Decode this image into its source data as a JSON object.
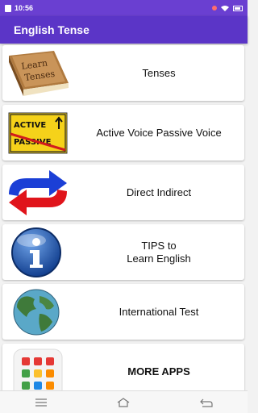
{
  "status": {
    "time": "10:56"
  },
  "app": {
    "title": "English Tense"
  },
  "items": [
    {
      "label": "Tenses",
      "icon": "book-icon",
      "thumb_text": [
        "Learn",
        "Tenses"
      ]
    },
    {
      "label": "Active Voice Passive Voice",
      "icon": "active-passive-sign-icon",
      "thumb_text": [
        "ACTIVE",
        "PASSIVE"
      ]
    },
    {
      "label": "Direct Indirect",
      "icon": "swap-arrows-icon"
    },
    {
      "label": "TIPS to\nLearn English",
      "icon": "info-icon"
    },
    {
      "label": "International Test",
      "icon": "globe-icon"
    },
    {
      "label": "MORE APPS",
      "icon": "apps-grid-icon"
    }
  ],
  "colors": {
    "status_bar": "#6a3fd1",
    "app_bar": "#5b35c7",
    "card": "#ffffff"
  }
}
